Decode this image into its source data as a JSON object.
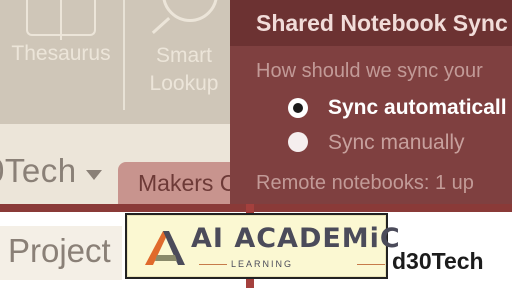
{
  "ribbon": {
    "thesaurus_label": "Thesaurus",
    "smart_lookup_label": "Smart\nLookup"
  },
  "notebook": {
    "name": "0Tech",
    "tab_label": "Makers C",
    "section_label": "Project",
    "right_text": "d30Tech"
  },
  "flyout": {
    "title": "Shared Notebook Sync",
    "question": "How should we sync your",
    "options": [
      {
        "label": "Sync automaticall",
        "selected": true
      },
      {
        "label": "Sync manually",
        "selected": false
      }
    ],
    "status": "Remote notebooks: 1 up"
  },
  "watermark": {
    "title": "AI ACADEMiC",
    "subtitle": "LEARNING"
  },
  "colors": {
    "flyout_bg": "#7f4040",
    "accent": "#8a3a38",
    "ribbon_bg": "#cfc6b8"
  }
}
